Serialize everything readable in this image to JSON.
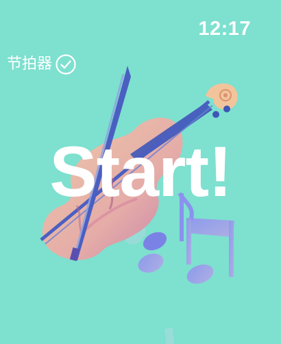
{
  "status_bar": {
    "time": "12:17"
  },
  "header": {
    "title": "节拍器",
    "check_icon": "check-circle-icon"
  },
  "main": {
    "start_label": "Start!"
  },
  "colors": {
    "background": "#7ee0cf",
    "text": "#ffffff",
    "violin_body": "#f2b7a4",
    "violin_shade": "#d98ea0",
    "strings": "#4a5fc1",
    "notes": "#7b82e6"
  }
}
